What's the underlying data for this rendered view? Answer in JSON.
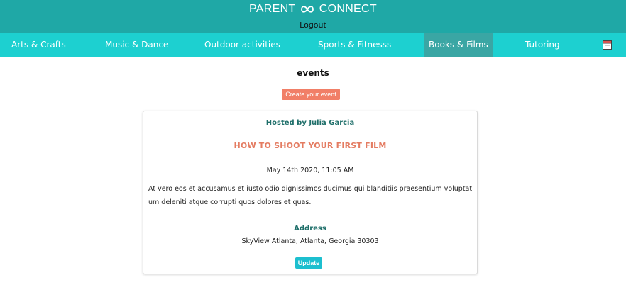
{
  "header": {
    "brand_left": "PARENT",
    "brand_right": "CONNECT",
    "brand_icon": "infinity-icon",
    "logout_label": "Logout",
    "colors": {
      "topbar": "#1fa8a6",
      "navbar": "#1dd0d0",
      "active_tab": "#3aa6a4"
    }
  },
  "nav": {
    "items": [
      {
        "label": "Arts & Crafts"
      },
      {
        "label": "Music & Dance"
      },
      {
        "label": "Outdoor activities"
      },
      {
        "label": "Sports & Fitnesss"
      },
      {
        "label": "Books & Films",
        "active": true
      },
      {
        "label": "Tutoring"
      }
    ],
    "calendar_icon": "calendar-icon"
  },
  "main": {
    "heading": "events",
    "create_button": "Create your event",
    "create_button_color": "#f17f67"
  },
  "event": {
    "host": "Hosted by Julia Garcia",
    "title": "HOW TO SHOOT YOUR FIRST FILM",
    "datetime": "May 14th 2020, 11:05 AM",
    "description_line1": "At vero eos et accusamus et iusto odio dignissimos ducimus qui blanditiis praesentium voluptat",
    "description_line2": "um deleniti atque corrupti quos dolores et quas.",
    "address_label": "Address",
    "address": "SkyView Atlanta, Atlanta, Georgia 30303",
    "update_button": "Update",
    "title_color": "#e47c62",
    "update_button_color": "#1dbfcf"
  }
}
